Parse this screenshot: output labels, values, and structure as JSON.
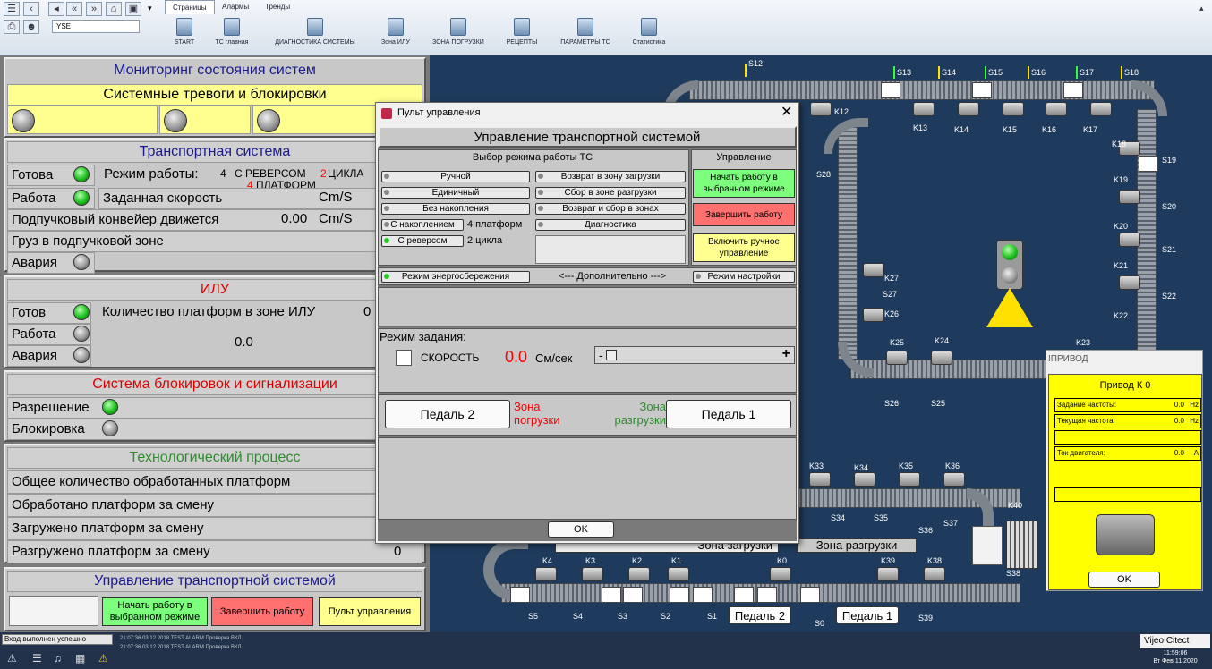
{
  "toolbar": {
    "combo_value": "YSE",
    "tabs": [
      "Страницы",
      "Алармы",
      "Тренды"
    ],
    "pages": [
      "START",
      "ТС главная",
      "ДИАГНОСТИКА СИСТЕМЫ",
      "Зона ИЛУ",
      "ЗОНА ПОГРУЗКИ",
      "РЕЦЕПТЫ",
      "ПАРАМЕТРЫ ТС",
      "Статистика"
    ]
  },
  "left": {
    "title": "Мониторинг состояния систем",
    "alarms_header": "Системные тревоги и блокировки",
    "transport": {
      "header": "Транспортная система",
      "ready": "Готова",
      "mode_label": "Режим работы:",
      "mode_num1": "4",
      "mode_text1": "С РЕВЕРСОМ",
      "mode_num2": "2",
      "mode_text2": "ЦИКЛА",
      "mode_num3": "4",
      "mode_text3": "ПЛАТФОРМ",
      "work": "Работа",
      "speed_label": "Заданная скорость",
      "speed_unit": "Cm/S",
      "under_label": "Подпучковый конвейер движется",
      "under_value": "0.00",
      "under_unit": "Cm/S",
      "cargo": "Груз в подпучковой зоне",
      "alarm": "Авария"
    },
    "ilu": {
      "header": "ИЛУ",
      "ready": "Готов",
      "count_label": "Количество  платформ в зоне ИЛУ",
      "count_value": "0",
      "work": "Работа",
      "value": "0.0",
      "alarm": "Авария"
    },
    "block": {
      "header": "Система блокировок и сигнализации",
      "permit": "Разрешение",
      "blocking": "Блокировка"
    },
    "tech": {
      "header": "Технологический процесс",
      "rows": [
        "Общее количество обработанных платформ",
        "Обработано  платформ за смену",
        "Загружено платформ за смену",
        "Разгружено платформ за смену"
      ],
      "last_value": "0"
    },
    "control": {
      "header": "Управление транспортной системой",
      "start": "Начать работу в выбранном режиме",
      "stop": "Завершить работу",
      "panel": "Пульт управления"
    }
  },
  "dialog": {
    "title": "Пульт управления",
    "header": "Управление транспортной системой",
    "mode_header": "Выбор режима работы ТС",
    "control_header": "Управление",
    "modes_left": [
      "Ручной",
      "Единичный",
      "Без накопления",
      "С накоплением",
      "С реверсом"
    ],
    "mode_info1": "4 платформ",
    "mode_info2": "2 цикла",
    "modes_right": [
      "Возврат в зону загрузки",
      "Сбор в зоне разгрузки",
      "Возврат и сбор в зонах",
      "Диагностика"
    ],
    "start": "Начать работу в выбранном режиме",
    "stop": "Завершить работу",
    "manual": "Включить ручное управление",
    "energy": "Режим энергосбережения",
    "extra": "<---   Дополнительно   --->",
    "tuning": "Режим настройки",
    "task_label": "Режим задания:",
    "speed_label": "СКОРОСТЬ",
    "speed_value": "0.0",
    "speed_unit": "См/сек",
    "pedal2": "Педаль 2",
    "zone_load": "Зона погрузки",
    "zone_unload": "Зона разгрузки",
    "pedal1": "Педаль 1",
    "ok": "OK"
  },
  "scene": {
    "zone_load": "Зона загрузки",
    "zone_unload": "Зона разгрузки",
    "pedal2": "Педаль 2",
    "pedal1": "Педаль 1",
    "sensors": [
      "S12",
      "S13",
      "S14",
      "S15",
      "S16",
      "S17",
      "S18",
      "S19",
      "S20",
      "S21",
      "S22",
      "S28",
      "S27",
      "S26",
      "S25",
      "S34",
      "S35",
      "S36",
      "S37",
      "S38",
      "S39",
      "S5",
      "S4",
      "S3",
      "S2",
      "S1",
      "S0"
    ],
    "motors": [
      "K12",
      "K13",
      "K14",
      "K15",
      "K16",
      "K17",
      "K18",
      "K19",
      "K20",
      "K21",
      "K22",
      "K23",
      "K27",
      "K26",
      "K25",
      "K24",
      "K33",
      "K34",
      "K35",
      "K36",
      "K40",
      "K4",
      "K3",
      "K2",
      "K1",
      "K0",
      "K39",
      "K38"
    ]
  },
  "privod": {
    "window_title": "!ПРИВОД",
    "title": "Привод К  0",
    "f1_label": "Задание частоты:",
    "f1_value": "0.0",
    "f1_unit": "Hz",
    "f2_label": "Текущая частота:",
    "f2_value": "0.0",
    "f2_unit": "Hz",
    "f3_label": "Ток двигателя:",
    "f3_value": "0.0",
    "f3_unit": "A",
    "ok": "OK"
  },
  "status": {
    "login": "Вход выполнен успешно",
    "alarm1": "21:07:36      03.12.2018    TEST  ALARM   Проверка          ВКЛ.",
    "alarm2": "21:07:36      03.12.2018    TEST  ALARM   Проверка          ВКЛ.",
    "brand": "Vijeo Citect",
    "time": "11:59:06",
    "date": "Вт Фев 11 2020"
  },
  "colors": {
    "scene_bg": "#1e3a5c",
    "led_green": "#1cc01c",
    "accent_red": "#ff0000",
    "accent_green": "#2e8b2e",
    "title_blue": "#1a1a8c"
  }
}
